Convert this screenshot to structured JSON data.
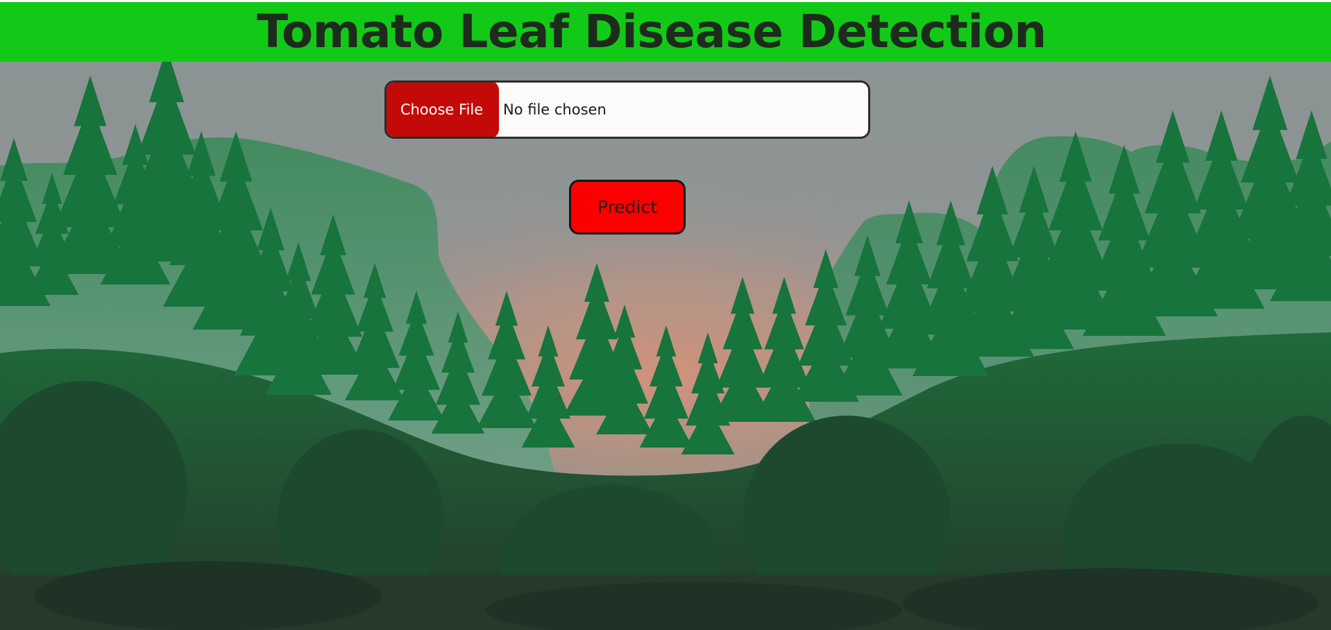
{
  "page": {
    "title": "Tomato Leaf Disease Detection"
  },
  "upload": {
    "button_label": "Choose File",
    "status_text": "No file chosen"
  },
  "actions": {
    "predict_label": "Predict"
  },
  "background": {
    "description_icon": "forest-mountain-landscape"
  },
  "colors": {
    "header_bg": "#13c918",
    "choose_button": "#c30a08",
    "predict_button": "#fc0000",
    "title_text": "#1d2b1d"
  }
}
